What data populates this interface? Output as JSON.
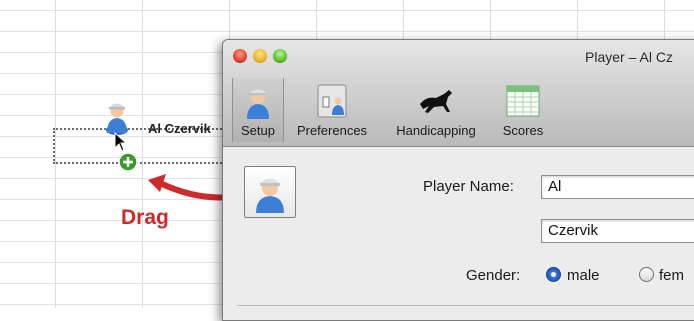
{
  "drag_preview": {
    "label": "Al Czervik"
  },
  "annotation": {
    "text": "Drag"
  },
  "window": {
    "title": "Player – Al Cz"
  },
  "toolbar": {
    "items": [
      {
        "label": "Setup",
        "icon": "player-icon"
      },
      {
        "label": "Preferences",
        "icon": "preferences-icon"
      },
      {
        "label": "Handicapping",
        "icon": "horse-icon"
      },
      {
        "label": "Scores",
        "icon": "scorecard-icon"
      }
    ],
    "selected": "Setup"
  },
  "form": {
    "player_name_label": "Player Name:",
    "first_name": "Al",
    "last_name": "Czervik",
    "gender_label": "Gender:",
    "gender_options": [
      "male",
      "fem"
    ],
    "gender_selected": "male"
  },
  "colors": {
    "annotation": "#cc2b2b",
    "accent": "#2f6fd8"
  }
}
